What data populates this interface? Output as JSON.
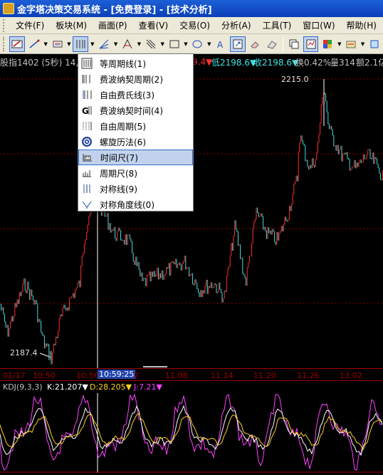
{
  "window": {
    "title": "金字塔决策交易系统 - [免费登录] - [技术分析]"
  },
  "menu": [
    "文件(F)",
    "板块(M)",
    "画面(P)",
    "查看(V)",
    "交易(O)",
    "分析(A)",
    "工具(T)",
    "窗口(W)",
    "帮助(H)"
  ],
  "infobar": {
    "symbol": "股指1402 (5秒)  14,",
    "mid": "9.4▼",
    "low": "低2198.6▼",
    "close": "收2198.6▼",
    "turnover": "换0.42%",
    "volume": "量314",
    "amount": "额2.1亿"
  },
  "price_labels": {
    "high": "2215.0",
    "low": "2187.4"
  },
  "timeaxis": {
    "labels": [
      "01/17",
      "10:50",
      "10:56",
      "10:59:25",
      "2",
      "11:08",
      "11:14",
      "11:20",
      "11:26",
      "13:02"
    ],
    "highlight": "10:59:25"
  },
  "kdj": {
    "name": "KDJ(9,3,3)",
    "k": "K:21.207▼",
    "d": "D:28.205▼",
    "j": "J:7.21▼"
  },
  "dropdown": {
    "items": [
      {
        "label": "等周期线(1)",
        "icon": "equal-period-lines-icon"
      },
      {
        "label": "费波纳契周期(2)",
        "icon": "fibonacci-period-icon"
      },
      {
        "label": "自由费氏线(3)",
        "icon": "free-fibonacci-icon"
      },
      {
        "label": "费波纳契时间(4)",
        "icon": "fibonacci-time-icon"
      },
      {
        "label": "自由周期(5)",
        "icon": "free-period-icon"
      },
      {
        "label": "螺旋历法(6)",
        "icon": "spiral-calendar-icon"
      },
      {
        "label": "时间尺(7)",
        "icon": "time-ruler-icon"
      },
      {
        "label": "周期尺(8)",
        "icon": "period-ruler-icon"
      },
      {
        "label": "对称线(9)",
        "icon": "symmetry-line-icon"
      },
      {
        "label": "对称角度线(0)",
        "icon": "symmetry-angle-icon"
      }
    ],
    "selected_index": 6
  },
  "colors": {
    "up": "#ff3030",
    "down": "#40e0e0",
    "k_line": "#ffffff",
    "d_line": "#ffd020",
    "j_line": "#ff40ff",
    "axis": "#a00000"
  }
}
